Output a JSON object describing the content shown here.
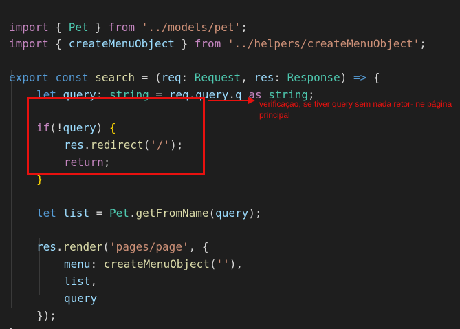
{
  "code": {
    "l1": {
      "import_kw": "import",
      "open": " { ",
      "name": "Pet",
      "close": " } ",
      "from_kw": "from",
      "space": " ",
      "path": "'../models/pet'",
      "semi": ";"
    },
    "l2": {
      "import_kw": "import",
      "open": " { ",
      "name": "createMenuObject",
      "close": " } ",
      "from_kw": "from",
      "space": " ",
      "path": "'../helpers/createMenuObject'",
      "semi": ";"
    },
    "l4": {
      "export_kw": "export",
      "s1": " ",
      "const_kw": "const",
      "s2": " ",
      "name": "search",
      "eq": " = (",
      "req": "req",
      "c1": ": ",
      "req_type": "Request",
      "comma": ", ",
      "res": "res",
      "c2": ": ",
      "res_type": "Response",
      "close_paren": ") ",
      "arrow": "=>",
      "brace": " {"
    },
    "l5": {
      "let_kw": "let",
      "s1": " ",
      "query": "query",
      "c1": ": ",
      "string_type": "string",
      "eq": " = ",
      "req": "req",
      "dot1": ".",
      "query_prop": "query",
      "dot2": ".",
      "q_prop": "q",
      "s2": " ",
      "as_kw": "as",
      "s3": " ",
      "string_type2": "string",
      "semi": ";"
    },
    "l7": {
      "if_kw": "if",
      "paren_open": "(!",
      "query": "query",
      "paren_close": ") ",
      "brace": "{"
    },
    "l8": {
      "res": "res",
      "dot": ".",
      "redirect": "redirect",
      "open": "(",
      "path": "'/'",
      "close": ");"
    },
    "l9": {
      "return_kw": "return",
      "semi": ";"
    },
    "l10": {
      "brace": "}"
    },
    "l12": {
      "let_kw": "let",
      "s1": " ",
      "list": "list",
      "eq": " = ",
      "pet": "Pet",
      "dot": ".",
      "fn": "getFromName",
      "open": "(",
      "query": "query",
      "close": ");"
    },
    "l14": {
      "res": "res",
      "dot": ".",
      "render": "render",
      "open": "(",
      "path": "'pages/page'",
      "comma": ", {"
    },
    "l15": {
      "menu": "menu",
      "colon": ": ",
      "fn": "createMenuObject",
      "open": "(",
      "arg": "''",
      "close": "),"
    },
    "l16": {
      "list": "list",
      "comma": ","
    },
    "l17": {
      "query": "query"
    },
    "l18": {
      "close": "});"
    },
    "l19": {
      "close": "}"
    }
  },
  "annotation": {
    "text": "verificaçao, se tiver query sem nada retor- ne  página principal"
  },
  "colors": {
    "background": "#1e1e1e",
    "keyword": "#569cd6",
    "control": "#c586c0",
    "string": "#ce9178",
    "variable": "#9cdcfe",
    "function": "#dcdcaa",
    "type": "#4ec9b0",
    "annotation_red": "#e8110f"
  }
}
